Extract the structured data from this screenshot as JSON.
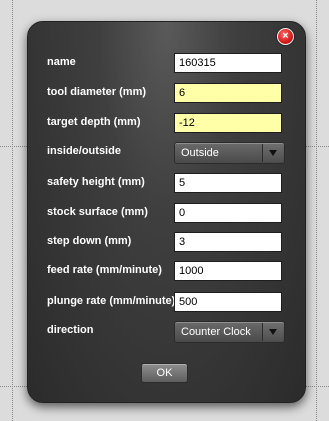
{
  "dialog": {
    "close_symbol": "×",
    "fields": {
      "name": {
        "label": "name",
        "value": "160315"
      },
      "tool_diameter": {
        "label": "tool diameter (mm)",
        "value": "6"
      },
      "target_depth": {
        "label": "target depth (mm)",
        "value": "-12"
      },
      "inside_outside": {
        "label": "inside/outside",
        "value": "Outside"
      },
      "safety_height": {
        "label": "safety height (mm)",
        "value": "5"
      },
      "stock_surface": {
        "label": "stock surface (mm)",
        "value": "0"
      },
      "step_down": {
        "label": "step down (mm)",
        "value": "3"
      },
      "feed_rate": {
        "label": "feed rate (mm/minute)",
        "value": "1000"
      },
      "plunge_rate": {
        "label": "plunge rate (mm/minute)",
        "value": "500"
      },
      "direction": {
        "label": "direction",
        "value": "Counter Clock"
      }
    },
    "ok_label": "OK"
  },
  "colors": {
    "highlight_field": "#ffffa8",
    "close_red": "#d61a1a",
    "panel_dark": "#2b2b2b"
  },
  "icons": {
    "close": "close-icon",
    "dropdown": "chevron-down-icon"
  }
}
